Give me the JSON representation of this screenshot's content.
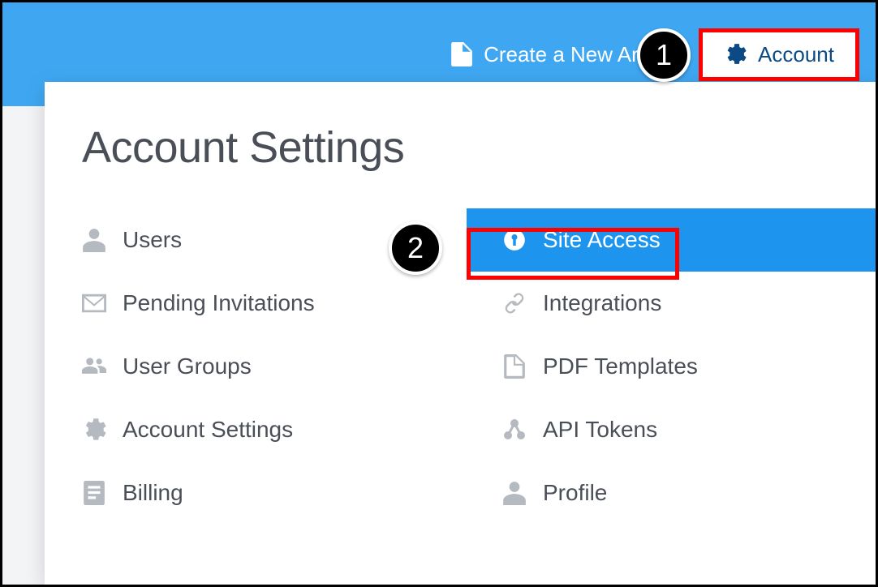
{
  "header": {
    "create_label": "Create a New Article",
    "account_label": "Account"
  },
  "panel": {
    "title": "Account Settings"
  },
  "menu_left": [
    {
      "label": "Users"
    },
    {
      "label": "Pending Invitations"
    },
    {
      "label": "User Groups"
    },
    {
      "label": "Account Settings"
    },
    {
      "label": "Billing"
    }
  ],
  "menu_right": [
    {
      "label": "Site Access"
    },
    {
      "label": "Integrations"
    },
    {
      "label": "PDF Templates"
    },
    {
      "label": "API Tokens"
    },
    {
      "label": "Profile"
    }
  ],
  "badges": {
    "one": "1",
    "two": "2"
  }
}
